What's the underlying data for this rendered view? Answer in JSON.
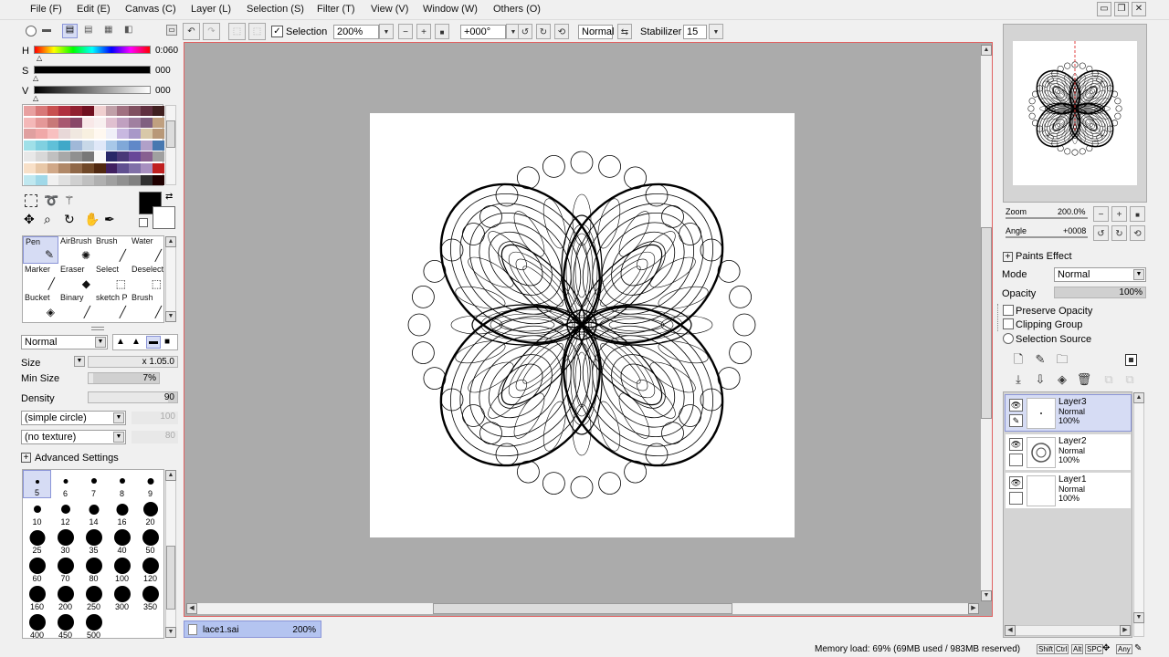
{
  "menu": [
    {
      "label": "File (F)"
    },
    {
      "label": "Edit (E)"
    },
    {
      "label": "Canvas (C)"
    },
    {
      "label": "Layer (L)"
    },
    {
      "label": "Selection (S)"
    },
    {
      "label": "Filter (T)"
    },
    {
      "label": "View (V)"
    },
    {
      "label": "Window (W)"
    },
    {
      "label": "Others (O)"
    }
  ],
  "window_controls": {
    "minimize": "▭",
    "restore": "❐",
    "close": "✕"
  },
  "toolbar": {
    "selection_label": "Selection",
    "zoom_value": "200%",
    "angle_value": "+000°",
    "blend_value": "Normal",
    "stabilizer_label": "Stabilizer",
    "stabilizer_value": "15"
  },
  "color": {
    "h_label": "H",
    "h_value": "0:060",
    "s_label": "S",
    "s_value": "000",
    "v_label": "V",
    "v_value": "000",
    "primary": "#000000",
    "secondary": "#ffffff",
    "swatches": [
      "#e8a0a0",
      "#d87878",
      "#c85050",
      "#b03040",
      "#902030",
      "#701020",
      "#f0d0d0",
      "#c0a0a8",
      "#a07080",
      "#805060",
      "#603040",
      "#402020",
      "#f4b8b8",
      "#e49898",
      "#c87878",
      "#a85870",
      "#884868",
      "#f8e8e8",
      "#f8f0f0",
      "#e0c0d0",
      "#c0a0c0",
      "#a080a0",
      "#806080",
      "#c0a080",
      "#e0a0a0",
      "#f0a8a8",
      "#f8c0c0",
      "#e8d8d8",
      "#f0e8e0",
      "#f8f0e0",
      "#fff8f0",
      "#f0f0f8",
      "#c8b8e0",
      "#a898c8",
      "#d8c8a8",
      "#b89878",
      "#a0e0e8",
      "#80d0e0",
      "#60c0d8",
      "#40a8c8",
      "#a0b8d8",
      "#c8d8e8",
      "#e0e8f8",
      "#a8c8e8",
      "#80a8d8",
      "#6088c8",
      "#b0a0c8",
      "#4878b0",
      "#e8e8e8",
      "#d8d8d8",
      "#c0c0c0",
      "#a8a8a8",
      "#909090",
      "#787878",
      "#f8f8f8",
      "#282868",
      "#483878",
      "#684898",
      "#886090",
      "#a0a0a0",
      "#f8e0c8",
      "#e8c8a8",
      "#d0a888",
      "#b08868",
      "#906848",
      "#704828",
      "#502810",
      "#402060",
      "#605090",
      "#8070a8",
      "#a890c0",
      "#c02020",
      "#c0e8f0",
      "#a0d8e8",
      "#f0f0f0",
      "#e0e0e0",
      "#d0d0d0",
      "#c0c0c0",
      "#b0b0b0",
      "#a0a0a0",
      "#909090",
      "#808080",
      "#303030",
      "#200000"
    ]
  },
  "tools": [
    {
      "label": "Pen",
      "icon": "✎",
      "selected": true
    },
    {
      "label": "AirBrush",
      "icon": "✺",
      "selected": false
    },
    {
      "label": "Brush",
      "icon": "╱",
      "selected": false
    },
    {
      "label": "Water",
      "icon": "╱",
      "selected": false
    },
    {
      "label": "Marker",
      "icon": "╱",
      "selected": false
    },
    {
      "label": "Eraser",
      "icon": "◆",
      "selected": false
    },
    {
      "label": "Select",
      "icon": "⬚",
      "selected": false
    },
    {
      "label": "Deselect",
      "icon": "⬚",
      "selected": false
    },
    {
      "label": "Bucket",
      "icon": "◈",
      "selected": false
    },
    {
      "label": "Binary",
      "icon": "╱",
      "selected": false
    },
    {
      "label": "sketch P",
      "icon": "╱",
      "selected": false
    },
    {
      "label": "Brush",
      "icon": "╱",
      "selected": false
    }
  ],
  "brush": {
    "blend_mode": "Normal",
    "size_label": "Size",
    "size_mult": "x 1.0",
    "size_value": "5.0",
    "min_size_label": "Min Size",
    "min_size_value": "7%",
    "min_size_fraction": 0.07,
    "density_label": "Density",
    "density_value": "90",
    "density_fraction": 0.9,
    "shape": "(simple circle)",
    "shape_value": "100",
    "texture": "(no texture)",
    "texture_value": "80",
    "advanced_label": "Advanced Settings"
  },
  "brush_sizes": [
    {
      "label": "5",
      "d": 4
    },
    {
      "label": "6",
      "d": 5
    },
    {
      "label": "7",
      "d": 6
    },
    {
      "label": "8",
      "d": 6
    },
    {
      "label": "9",
      "d": 7
    },
    {
      "label": "10",
      "d": 8
    },
    {
      "label": "12",
      "d": 10
    },
    {
      "label": "14",
      "d": 11
    },
    {
      "label": "16",
      "d": 13
    },
    {
      "label": "20",
      "d": 16
    },
    {
      "label": "25",
      "d": 17
    },
    {
      "label": "30",
      "d": 18
    },
    {
      "label": "35",
      "d": 18
    },
    {
      "label": "40",
      "d": 18
    },
    {
      "label": "50",
      "d": 18
    },
    {
      "label": "60",
      "d": 18
    },
    {
      "label": "70",
      "d": 18
    },
    {
      "label": "80",
      "d": 18
    },
    {
      "label": "100",
      "d": 18
    },
    {
      "label": "120",
      "d": 18
    },
    {
      "label": "160",
      "d": 18
    },
    {
      "label": "200",
      "d": 18
    },
    {
      "label": "250",
      "d": 18
    },
    {
      "label": "300",
      "d": 18
    },
    {
      "label": "350",
      "d": 18
    },
    {
      "label": "400",
      "d": 18
    },
    {
      "label": "450",
      "d": 18
    },
    {
      "label": "500",
      "d": 18
    }
  ],
  "navigator": {
    "zoom_label": "Zoom",
    "zoom_value": "200.0%",
    "angle_label": "Angle",
    "angle_value": "+0008"
  },
  "layer_panel": {
    "paints_effect_label": "Paints Effect",
    "mode_label": "Mode",
    "mode_value": "Normal",
    "opacity_label": "Opacity",
    "opacity_value": "100%",
    "preserve_opacity": "Preserve Opacity",
    "clipping_group": "Clipping Group",
    "selection_source": "Selection Source",
    "layers": [
      {
        "name": "Layer3",
        "mode": "Normal",
        "opacity": "100%",
        "selected": true
      },
      {
        "name": "Layer2",
        "mode": "Normal",
        "opacity": "100%",
        "selected": false
      },
      {
        "name": "Layer1",
        "mode": "Normal",
        "opacity": "100%",
        "selected": false
      }
    ]
  },
  "document_tab": {
    "name": "lace1.sai",
    "zoom": "200%"
  },
  "status": {
    "memory": "Memory load: 69% (69MB used / 983MB reserved)",
    "keys": [
      "Shift",
      "Ctrl",
      "Alt",
      "SPC",
      "Any"
    ]
  }
}
